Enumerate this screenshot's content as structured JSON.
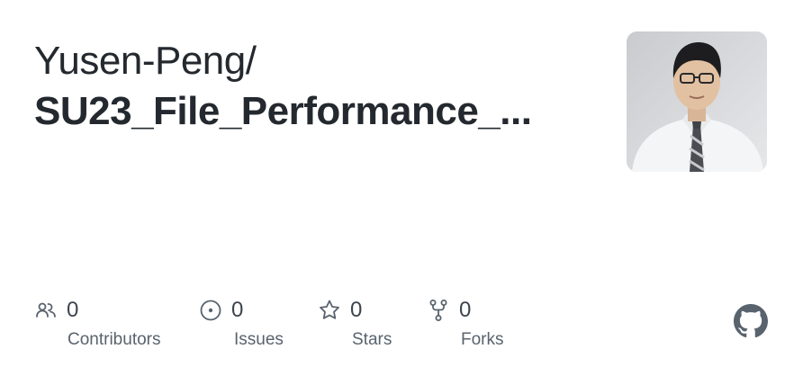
{
  "card": {
    "owner": "Yusen-Peng/",
    "repo": "SU23_File_Performance_...",
    "avatar_alt": "avatar",
    "stats": [
      {
        "icon": "people-icon",
        "count": "0",
        "label": "Contributors"
      },
      {
        "icon": "issue-icon",
        "count": "0",
        "label": "Issues"
      },
      {
        "icon": "star-icon",
        "count": "0",
        "label": "Stars"
      },
      {
        "icon": "fork-icon",
        "count": "0",
        "label": "Forks"
      }
    ],
    "logo_icon": "github-icon"
  }
}
